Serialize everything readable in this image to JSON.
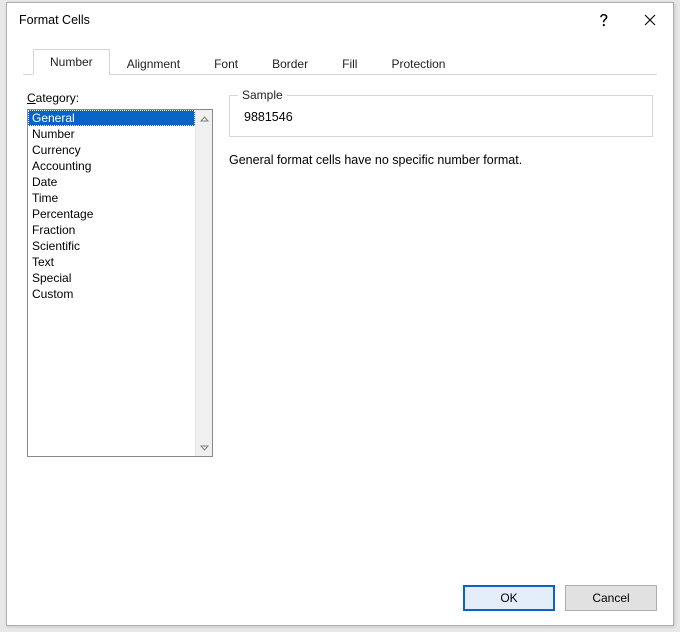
{
  "titlebar": {
    "title": "Format Cells"
  },
  "tabs": [
    {
      "label": "Number",
      "active": true
    },
    {
      "label": "Alignment",
      "active": false
    },
    {
      "label": "Font",
      "active": false
    },
    {
      "label": "Border",
      "active": false
    },
    {
      "label": "Fill",
      "active": false
    },
    {
      "label": "Protection",
      "active": false
    }
  ],
  "category": {
    "label_pre": "C",
    "label_post": "ategory:",
    "items": [
      {
        "label": "General",
        "selected": true
      },
      {
        "label": "Number",
        "selected": false
      },
      {
        "label": "Currency",
        "selected": false
      },
      {
        "label": "Accounting",
        "selected": false
      },
      {
        "label": "Date",
        "selected": false
      },
      {
        "label": "Time",
        "selected": false
      },
      {
        "label": "Percentage",
        "selected": false
      },
      {
        "label": "Fraction",
        "selected": false
      },
      {
        "label": "Scientific",
        "selected": false
      },
      {
        "label": "Text",
        "selected": false
      },
      {
        "label": "Special",
        "selected": false
      },
      {
        "label": "Custom",
        "selected": false
      }
    ]
  },
  "sample": {
    "legend": "Sample",
    "value": "9881546"
  },
  "description": "General format cells have no specific number format.",
  "buttons": {
    "ok": "OK",
    "cancel": "Cancel"
  }
}
